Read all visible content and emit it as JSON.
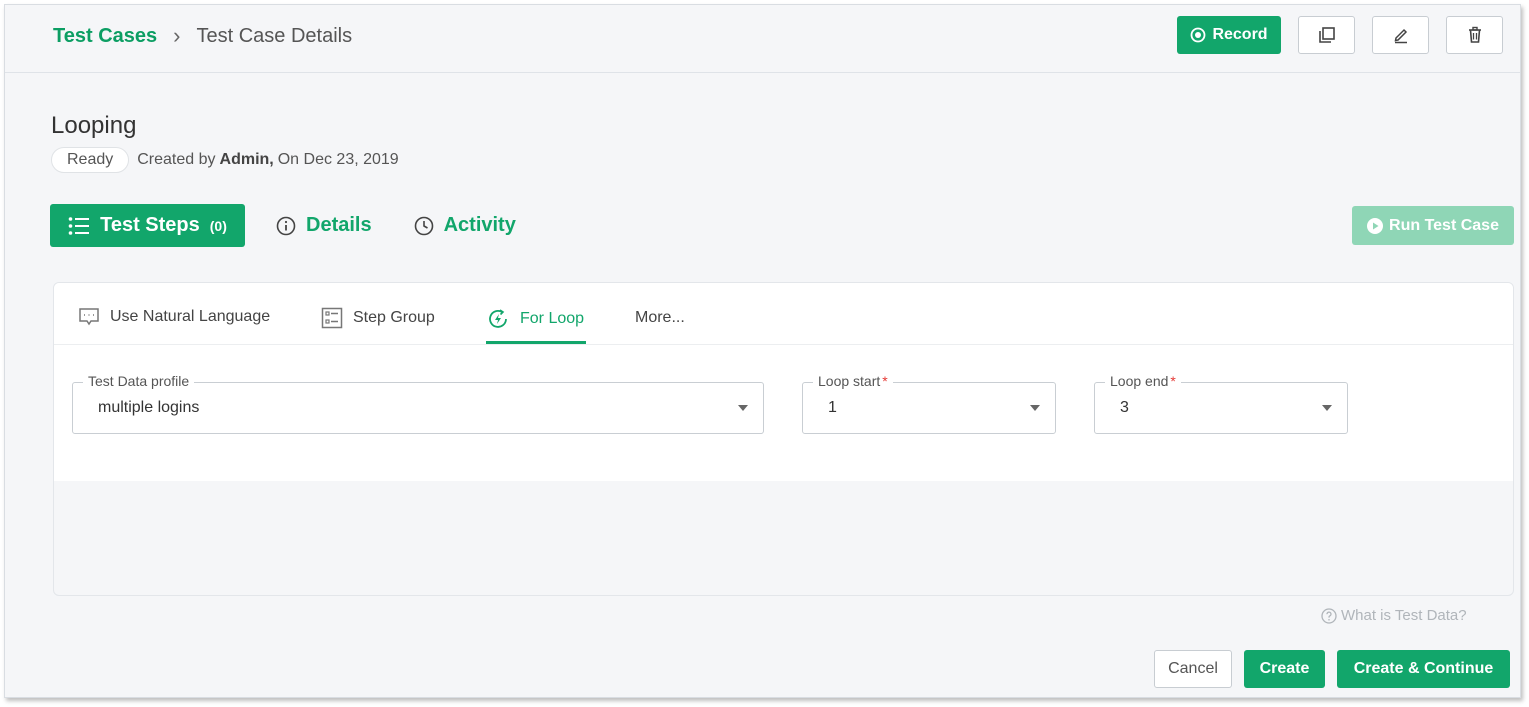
{
  "header": {
    "breadcrumb_root": "Test Cases",
    "breadcrumb_current": "Test Case Details",
    "record_label": "Record",
    "icons": [
      "copy-icon",
      "edit-icon",
      "trash-icon"
    ]
  },
  "test_case": {
    "title": "Looping",
    "status": "Ready",
    "created_prefix": "Created by",
    "author": "Admin,",
    "created_date": "On Dec 23, 2019"
  },
  "tabs": {
    "steps_label": "Test Steps",
    "steps_count": "(0)",
    "details_label": "Details",
    "activity_label": "Activity"
  },
  "run_label": "Run Test Case",
  "subtabs": {
    "natural_language": "Use Natural Language",
    "step_group": "Step Group",
    "for_loop": "For Loop",
    "more": "More..."
  },
  "form": {
    "profile_label": "Test Data profile",
    "profile_value": "multiple logins",
    "loop_start_label": "Loop start",
    "loop_start_value": "1",
    "loop_end_label": "Loop end",
    "loop_end_value": "3",
    "required_mark": "*"
  },
  "help_text": "What is Test Data?",
  "footer": {
    "cancel": "Cancel",
    "create": "Create",
    "create_continue": "Create & Continue"
  },
  "colors": {
    "primary": "#12a66b",
    "primary_disabled": "#8fd6b6",
    "background": "#f5f6f8",
    "required": "#e53935"
  }
}
